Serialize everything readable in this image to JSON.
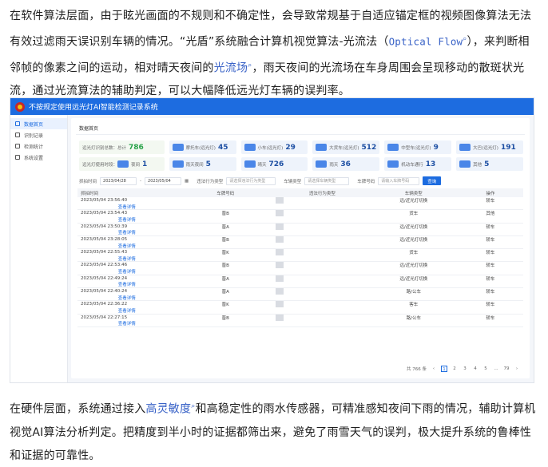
{
  "article": {
    "top_p1": "在软件算法层面，由于眩光画面的不规则和不确定性，会导致常规基于自适应锚定框的视频图像算法无法有效过滤雨天误识别车辆的情况。“光盾”系统融合计算机视觉算法-光流法（",
    "optical_flow": "Optical Flow",
    "top_p2": "），来判断相邻帧的像素之间的运动，相对晴天夜间的",
    "link_optical_field": "光流场",
    "top_p3": "，雨天夜间的光流场在车身周围会呈现移动的散斑状光流，通过光流算法的辅助判定，可以大幅降低远光灯车辆的误判率。",
    "bottom_p1": "在硬件层面，系统通过接入",
    "link_sensitivity": "高灵敏度",
    "bottom_p2": "和高稳定性的雨水传感器，可精准感知夜间下雨的情况，辅助计算机视觉AI算法分析判定。把精度到半小时的证据都筛出来，避免了雨雪天气的误判，极大提升系统的鲁棒性和证据的可靠性。"
  },
  "app": {
    "title": "不按规定使用远光灯AI智能检测记录系统",
    "brand_color": "#1d6ce0",
    "sidebar": [
      "数据首页",
      "识别记录",
      "检测统计",
      "系统设置"
    ],
    "section_title": "数据首页",
    "stats_row1": [
      {
        "label": "远光灯识别总数：",
        "prefix": "总计",
        "value": "786"
      },
      {
        "label": "摩托车(远光灯)",
        "value": "45"
      },
      {
        "label": "小车(远光灯)",
        "value": "29"
      },
      {
        "label": "大货车(远光灯)",
        "value": "512"
      },
      {
        "label": "中型车(远光灯)",
        "value": "9"
      },
      {
        "label": "大巴(远光灯)",
        "value": "191"
      }
    ],
    "stats_row2": [
      {
        "label": "远光灯使用时段：",
        "prefix": "夜间",
        "value": "1"
      },
      {
        "label": "雨天夜间",
        "value": "5"
      },
      {
        "label": "晴天",
        "value": "726"
      },
      {
        "label": "雨天",
        "value": "36"
      },
      {
        "label": "机动车通行",
        "value": "13"
      },
      {
        "label": "其他",
        "value": "5"
      }
    ],
    "filters": {
      "date_label": "抓拍时间",
      "date_from": "2023/04/28",
      "date_sep": "-",
      "date_to": "2023/05/04",
      "type_label": "违法行为类型",
      "type_placeholder": "请选择违法行为类型",
      "vehicle_label": "车辆类型",
      "vehicle_placeholder": "请选择车辆类型",
      "plate_label": "车牌号码",
      "plate_placeholder": "请输入车牌号码",
      "search_button": "查询"
    },
    "table": {
      "headers": [
        "抓拍时间",
        "车牌号码",
        "违法行为类型",
        "车辆类型",
        "操作"
      ],
      "rows": [
        {
          "time": "2023/05/04 23:56:40",
          "plate": "",
          "violation": "远/近光灯切换",
          "vehicle": "轿车",
          "op": "查看详情"
        },
        {
          "time": "2023/05/04 23:54:43",
          "plate": "晋B",
          "violation": "货车",
          "vehicle": "其他",
          "op": "查看详情"
        },
        {
          "time": "2023/05/04 23:50:39",
          "plate": "晋A",
          "violation": "远/近光灯切换",
          "vehicle": "轿车",
          "op": "查看详情"
        },
        {
          "time": "2023/05/04 23:28:05",
          "plate": "晋B",
          "violation": "远/近光灯切换",
          "vehicle": "轿车",
          "op": "查看详情"
        },
        {
          "time": "2023/05/04 22:55:43",
          "plate": "晋K",
          "violation": "货车",
          "vehicle": "轿车",
          "op": "查看详情"
        },
        {
          "time": "2023/05/04 22:53:46",
          "plate": "晋B",
          "violation": "远/近光灯切换",
          "vehicle": "轿车",
          "op": "查看详情"
        },
        {
          "time": "2023/05/04 22:49:24",
          "plate": "晋A",
          "violation": "远/近光灯切换",
          "vehicle": "轿车",
          "op": "查看详情"
        },
        {
          "time": "2023/05/04 22:40:24",
          "plate": "晋A",
          "violation": "路/公车",
          "vehicle": "轿车",
          "op": "查看详情"
        },
        {
          "time": "2023/05/04 22:36:22",
          "plate": "晋K",
          "violation": "客车",
          "vehicle": "轿车",
          "op": "查看详情"
        },
        {
          "time": "2023/05/04 22:27:15",
          "plate": "晋B",
          "violation": "路/公车",
          "vehicle": "轿车",
          "op": "查看详情"
        }
      ]
    },
    "pager": {
      "total": "共 766 条",
      "prev": "‹",
      "pages": [
        "1",
        "2",
        "3",
        "4",
        "5",
        "...",
        "79"
      ],
      "next": "›"
    }
  }
}
